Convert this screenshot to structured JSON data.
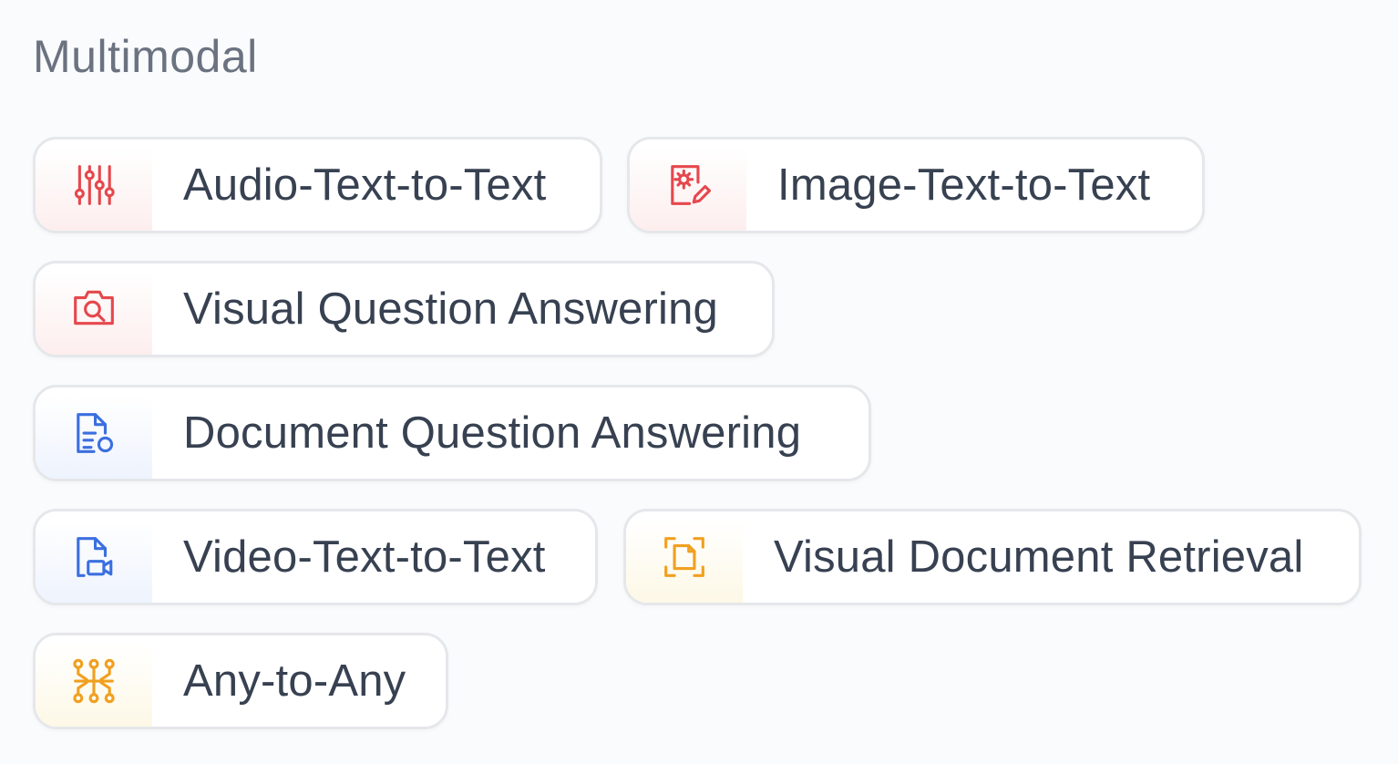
{
  "section": {
    "title": "Multimodal"
  },
  "colors": {
    "red": "#e5484d",
    "blue": "#3b6fe0",
    "yellow": "#f0a020"
  },
  "tasks": [
    {
      "label": "Audio-Text-to-Text",
      "icon": "sliders-icon",
      "color": "red"
    },
    {
      "label": "Image-Text-to-Text",
      "icon": "image-edit-icon",
      "color": "red"
    },
    {
      "label": "Visual Question Answering",
      "icon": "camera-search-icon",
      "color": "red"
    },
    {
      "label": "Document Question Answering",
      "icon": "document-search-icon",
      "color": "blue"
    },
    {
      "label": "Video-Text-to-Text",
      "icon": "document-video-icon",
      "color": "blue"
    },
    {
      "label": "Visual Document Retrieval",
      "icon": "scan-document-icon",
      "color": "yellow"
    },
    {
      "label": "Any-to-Any",
      "icon": "circuit-icon",
      "color": "yellow"
    }
  ]
}
